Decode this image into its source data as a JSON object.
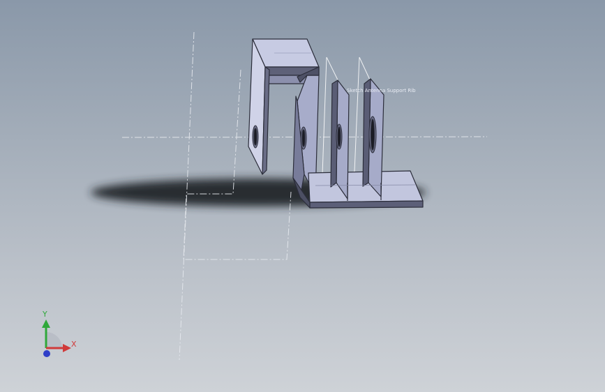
{
  "viewport": {
    "annotation": "Sketch  Antenna Support Rib"
  },
  "triad": {
    "x_label": "X",
    "y_label": "Y",
    "x_color": "#d03a3a",
    "y_color": "#2fa83a",
    "z_color": "#2f3fc8"
  },
  "colors": {
    "face_light": "#c9cde5",
    "face_mid": "#a9aecd",
    "face_dark": "#5d6078",
    "shadow": "#2a2e34",
    "centerline": "#e8ebf0"
  }
}
